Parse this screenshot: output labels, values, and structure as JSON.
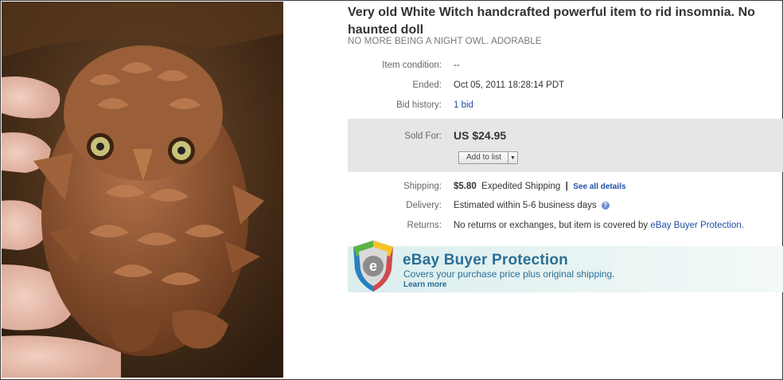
{
  "listing": {
    "title": "Very old White Witch handcrafted powerful item to rid insomnia. No haunted doll",
    "subtitle": "NO MORE BEING A NIGHT OWL. ADORABLE"
  },
  "details": {
    "condition_label": "Item condition:",
    "condition_value": "--",
    "ended_label": "Ended:",
    "ended_value": "Oct 05, 2011 18:28:14 PDT",
    "bid_label": "Bid history:",
    "bid_value": "1 bid"
  },
  "sold": {
    "label": "Sold For:",
    "price": "US $24.95",
    "add_to_list": "Add to list"
  },
  "shipping": {
    "label": "Shipping:",
    "price": "$5.80",
    "method": "Expedited Shipping",
    "separator": "|",
    "details_link": "See all details"
  },
  "delivery": {
    "label": "Delivery:",
    "value": "Estimated within 5-6 business days",
    "info_icon": "?"
  },
  "returns": {
    "label": "Returns:",
    "value": "No returns or exchanges, but item is covered by",
    "link": "eBay Buyer Protection."
  },
  "buyer_protection": {
    "title": "eBay Buyer Protection",
    "subtitle": "Covers your purchase price plus original shipping.",
    "learn_more": "Learn more",
    "logo_letter": "e"
  },
  "colors": {
    "link": "#1f4fa8",
    "protection_text": "#2a6f97",
    "sold_box": "#e6e6e6"
  },
  "icons": [
    "pinecone-owl-photo",
    "shield-icon",
    "dropdown-arrow-icon",
    "info-icon"
  ]
}
